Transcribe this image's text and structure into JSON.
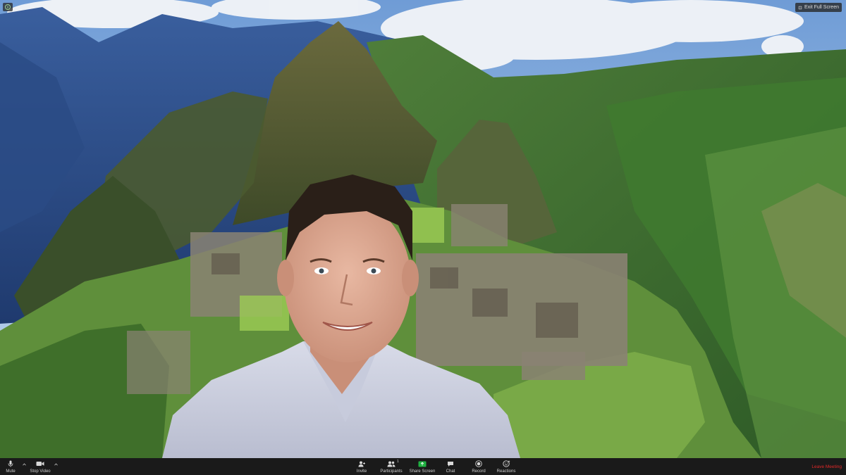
{
  "window": {
    "exit_full_screen_label": "Exit Full Screen"
  },
  "icons": {
    "top_left": "zoom-info-icon",
    "mute": "microphone-icon",
    "stop_video": "video-camera-icon",
    "invite": "add-person-icon",
    "participants": "people-icon",
    "share_screen": "share-screen-icon",
    "chat": "chat-bubble-icon",
    "record": "record-icon",
    "reactions": "smiley-icon"
  },
  "toolbar": {
    "mute_label": "Mute",
    "stop_video_label": "Stop Video",
    "invite_label": "Invite",
    "participants_label": "Participants",
    "participants_count": "1",
    "share_screen_label": "Share Screen",
    "chat_label": "Chat",
    "record_label": "Record",
    "reactions_label": "Reactions",
    "leave_label": "Leave Meeting"
  },
  "colors": {
    "toolbar_bg": "#1a1a1a",
    "share_green": "#1fb141",
    "leave_red": "#e02828"
  }
}
